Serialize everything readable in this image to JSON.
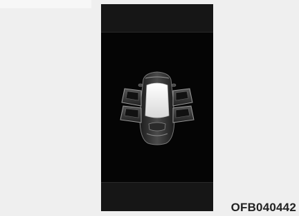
{
  "figure": {
    "code": "OFB040442",
    "icon": "car-doors-open-icon",
    "colors": {
      "page_background": "#efefef",
      "display_background": "#050505",
      "display_band": "#161616",
      "car_body": "#3a3a3a",
      "windshield": "#ffffff"
    }
  }
}
